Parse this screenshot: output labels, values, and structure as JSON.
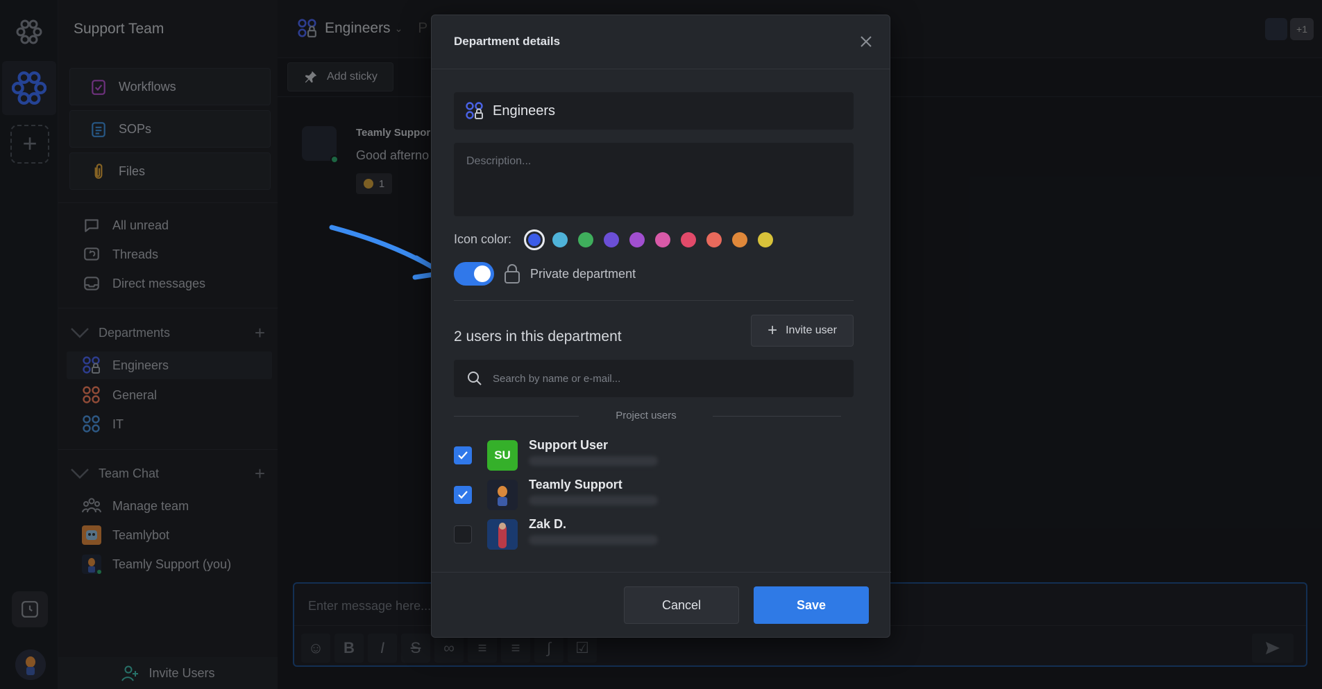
{
  "workspace": {
    "name": "Support Team"
  },
  "sidebar": {
    "cards": [
      {
        "label": "Workflows",
        "icon": "clipboard-check-icon"
      },
      {
        "label": "SOPs",
        "icon": "list-document-icon"
      },
      {
        "label": "Files",
        "icon": "paperclip-icon"
      }
    ],
    "views": [
      {
        "label": "All unread",
        "icon": "chat-bubble-icon"
      },
      {
        "label": "Threads",
        "icon": "threads-icon"
      },
      {
        "label": "Direct messages",
        "icon": "inbox-icon"
      }
    ],
    "departments_heading": "Departments",
    "departments": [
      {
        "label": "Engineers",
        "color": "#4a63e7",
        "private": true
      },
      {
        "label": "General",
        "color": "#e8795a",
        "private": false
      },
      {
        "label": "IT",
        "color": "#4a8fd6",
        "private": false
      }
    ],
    "team_chat_heading": "Team Chat",
    "team_chat": [
      {
        "label": "Manage team",
        "icon": "people-icon"
      },
      {
        "label": "Teamlybot",
        "icon": "bot-avatar"
      },
      {
        "label": "Teamly Support (you)",
        "icon": "user-avatar"
      }
    ],
    "invite_label": "Invite Users"
  },
  "channel": {
    "title": "Engineers",
    "title_suffix": "P"
  },
  "toolbar": {
    "add_sticky": "Add sticky"
  },
  "message": {
    "author": "Teamly Suppor",
    "text": "Good afterno",
    "reaction_count": "1"
  },
  "team": {
    "extra_members": "+1"
  },
  "composer": {
    "placeholder": "Enter message here...",
    "format_buttons": [
      "emoji-icon",
      "bold-icon",
      "italic-icon",
      "strikethrough-icon",
      "link-icon",
      "numbered-list-icon",
      "bulleted-list-icon",
      "attach-icon",
      "checklist-icon"
    ]
  },
  "modal": {
    "title": "Department details",
    "name_value": "Engineers",
    "description_placeholder": "Description...",
    "icon_color_label": "Icon color:",
    "colors": [
      "#3b5ce8",
      "#4fb3d9",
      "#3fae5c",
      "#6b4fd6",
      "#a14fd0",
      "#d85aa8",
      "#e24a6a",
      "#e86a5c",
      "#e0883a",
      "#d8c23a"
    ],
    "selected_color_index": 0,
    "private_label": "Private department",
    "private_on": true,
    "users_count_text": "2 users in this department",
    "invite_button": "Invite user",
    "search_placeholder": "Search by name or e-mail...",
    "project_users_label": "Project users",
    "users": [
      {
        "name": "Support User",
        "initials": "SU",
        "checked": true,
        "avatar_color": "#35b02a"
      },
      {
        "name": "Teamly Support",
        "initials": "",
        "checked": true,
        "avatar_color": "#1d2230"
      },
      {
        "name": "Zak D.",
        "initials": "",
        "checked": false,
        "avatar_color": "#1e3a66"
      }
    ],
    "cancel_label": "Cancel",
    "save_label": "Save"
  }
}
